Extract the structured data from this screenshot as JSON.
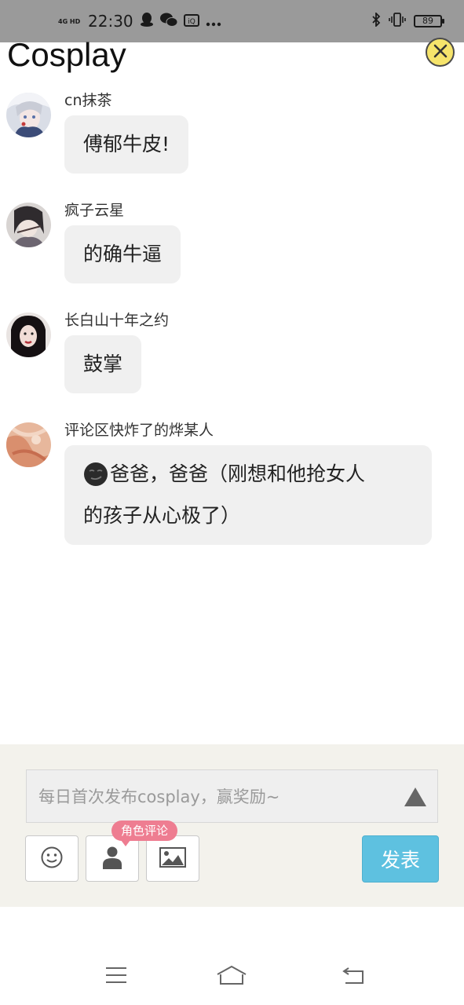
{
  "status_bar": {
    "network": "4G HD",
    "time": "22:30",
    "battery": "89",
    "icons": [
      "qq-icon",
      "wechat-icon",
      "iqiyi-icon",
      "more-dots-icon",
      "bluetooth-icon",
      "vibrate-icon",
      "battery-icon"
    ]
  },
  "page": {
    "title": "Cosplay",
    "close_icon": "close-icon",
    "accent_color": "#f6e46b"
  },
  "comments": [
    {
      "name": "cn抹茶",
      "text": "傅郁牛皮!"
    },
    {
      "name": "疯子云星",
      "text": "的确牛逼"
    },
    {
      "name": "长白山十年之约",
      "text": "鼓掌"
    },
    {
      "name": "评论区快炸了的烨某人",
      "text_line1": "爸爸，爸爸（刚想和他抢女人",
      "text_line2": "的孩子从心极了）",
      "emoji": "smirk-emoji-icon"
    }
  ],
  "composer": {
    "placeholder": "每日首次发布cosplay，赢奖励~",
    "role_tag": "角色评论",
    "publish_label": "发表",
    "publish_color": "#5ec1e0",
    "role_tag_color": "#ee7d91"
  },
  "nav": {
    "icons": [
      "menu-icon",
      "home-icon",
      "back-icon"
    ]
  }
}
